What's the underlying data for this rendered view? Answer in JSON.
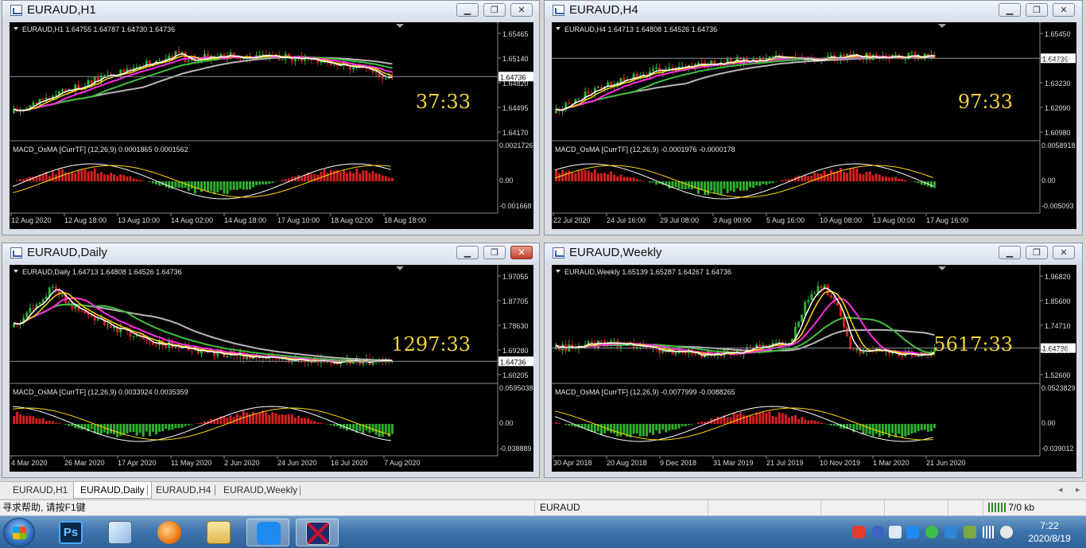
{
  "windows": [
    {
      "title": "EURAUD,H1",
      "header": "EURAUD,H1  1.64755 1.64787 1.64730 1.64736",
      "macd_header": "MACD_OsMA [CurrTF] (12,26,9) 0.0001865 0.0001562",
      "countdown": "37:33",
      "price_ticks": [
        "1.65465",
        "1.65140",
        "1.64820",
        "1.64495",
        "1.64170"
      ],
      "current_price": "1.64736",
      "macd_ticks": [
        "0.0021726",
        "0.00",
        "-0.001668"
      ],
      "time_labels": [
        "12 Aug 2020",
        "12 Aug 18:00",
        "13 Aug 10:00",
        "14 Aug 02:00",
        "14 Aug 18:00",
        "17 Aug 10:00",
        "18 Aug 02:00",
        "18 Aug 18:00"
      ],
      "close_active": false
    },
    {
      "title": "EURAUD,H4",
      "header": "EURAUD,H4  1.64713 1.64808 1.64526 1.64736",
      "macd_header": "MACD_OsMA [CurrTF] (12,26,9) -0.0001976 -0.0000178",
      "countdown": "97:33",
      "price_ticks": [
        "1.65450",
        "1.64340",
        "1.63230",
        "1.62090",
        "1.60980"
      ],
      "current_price": "1.64736",
      "macd_ticks": [
        "0.0058918",
        "0.00",
        "-0.005093"
      ],
      "time_labels": [
        "22 Jul 2020",
        "24 Jul 16:00",
        "29 Jul 08:00",
        "3 Aug 00:00",
        "5 Aug 16:00",
        "10 Aug 08:00",
        "13 Aug 00:00",
        "17 Aug 16:00"
      ],
      "close_active": false
    },
    {
      "title": "EURAUD,Daily",
      "header": "EURAUD,Daily  1.64713 1.64808 1.64526 1.64736",
      "macd_header": "MACD_OsMA [CurrTF] (12,26,9) 0.0033924 0.0035359",
      "countdown": "1297:33",
      "price_ticks": [
        "1.97055",
        "1.87705",
        "1.78630",
        "1.69280",
        "1.60205"
      ],
      "current_price": "1.64736",
      "macd_ticks": [
        "0.0595038",
        "0.00",
        "-0.038889"
      ],
      "time_labels": [
        "4 Mar 2020",
        "26 Mar 2020",
        "17 Apr 2020",
        "11 May 2020",
        "2 Jun 2020",
        "24 Jun 2020",
        "16 Jul 2020",
        "7 Aug 2020"
      ],
      "close_active": true
    },
    {
      "title": "EURAUD,Weekly",
      "header": "EURAUD,Weekly  1.65139 1.65287 1.64267 1.64736",
      "macd_header": "MACD_OsMA [CurrTF] (12,26,9) -0.0077999 -0.0088265",
      "countdown": "5617:33",
      "price_ticks": [
        "1.96820",
        "1.85600",
        "1.74710",
        "1.63490",
        "1.52600"
      ],
      "current_price": "1.64736",
      "macd_ticks": [
        "0.0523829",
        "0.00",
        "-0.039012"
      ],
      "time_labels": [
        "30 Apr 2018",
        "20 Aug 2018",
        "9 Dec 2018",
        "31 Mar 2019",
        "21 Jul 2019",
        "10 Nov 2019",
        "1 Mar 2020",
        "21 Jun 2020"
      ],
      "close_active": false
    }
  ],
  "window_buttons": {
    "minimize": "▁",
    "restore": "❐",
    "close": "✕"
  },
  "tabs": [
    {
      "label": "EURAUD,H1",
      "active": false
    },
    {
      "label": "EURAUD,Daily",
      "active": true
    },
    {
      "label": "EURAUD,H4",
      "active": false
    },
    {
      "label": "EURAUD,Weekly",
      "active": false
    }
  ],
  "tab_nav": {
    "left": "◂",
    "right": "▸"
  },
  "status": {
    "help": "寻求帮助, 请按F1键",
    "symbol": "EURAUD",
    "traffic": "7/0 kb"
  },
  "taskbar": {
    "apps": [
      "photoshop-icon",
      "paint-icon",
      "browser-icon",
      "file-explorer-icon",
      "pen-app-icon",
      "metatrader-icon"
    ],
    "ps_label": "Ps",
    "clock_time": "7:22",
    "clock_date": "2020/8/19"
  },
  "colors": {
    "chart_bg": "#000000",
    "bull": "#2fae2f",
    "bear": "#d42020",
    "countdown": "#f2d23a",
    "ma_white": "#ffffff",
    "ma_yellow": "#ffd400",
    "ma_magenta": "#ff2de0",
    "ma_green": "#3fbf3f",
    "ma_gray": "#b8b8b8"
  }
}
